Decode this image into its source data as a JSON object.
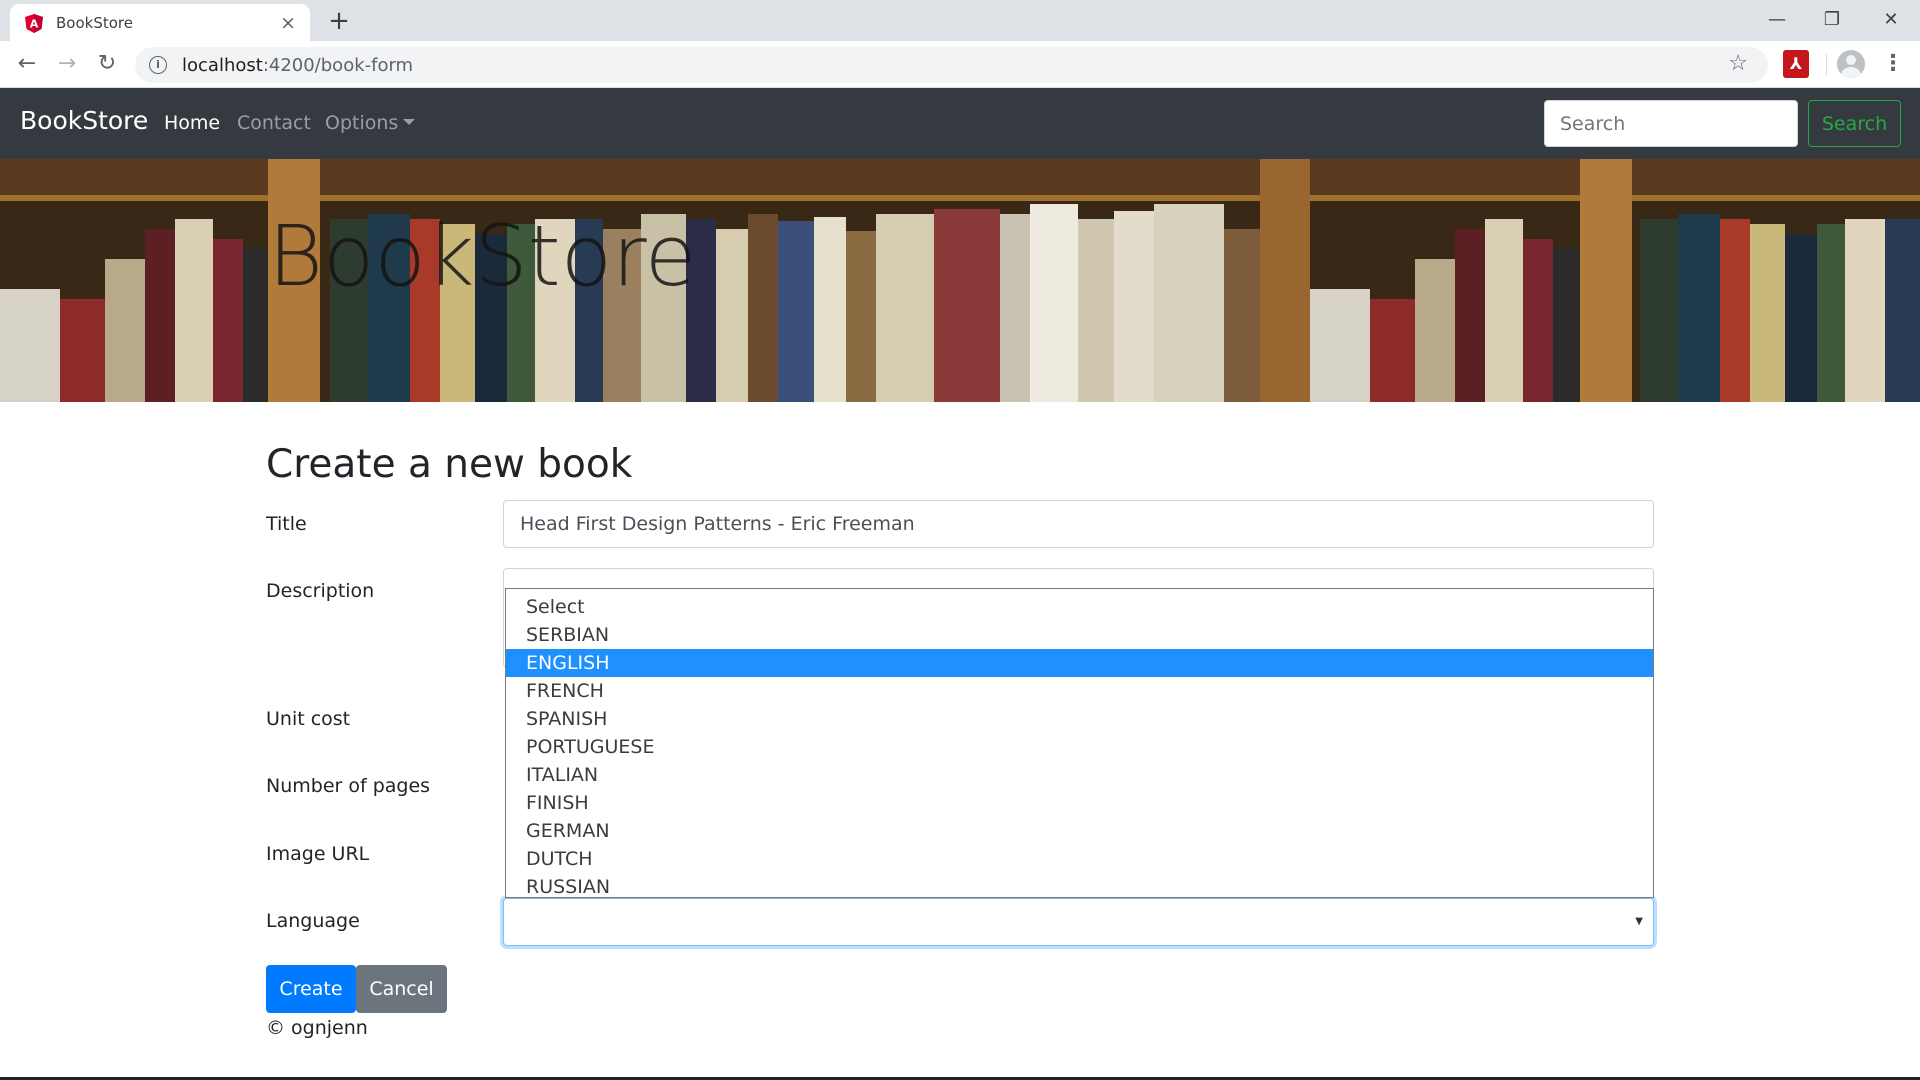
{
  "browser": {
    "tab_title": "BookStore",
    "url_host": "localhost",
    "url_path": ":4200/book-form",
    "new_tab": "+",
    "close_tab": "×",
    "minimize": "—",
    "restore": "❐",
    "close_window": "✕",
    "ext_label": "A"
  },
  "navbar": {
    "brand": "BookStore",
    "links": [
      "Home",
      "Contact",
      "Options"
    ],
    "search_placeholder": "Search",
    "search_button": "Search"
  },
  "hero": {
    "title": "BookStore"
  },
  "form": {
    "heading": "Create a new book",
    "title_label": "Title",
    "title_value": "Head First Design Patterns - Eric Freeman",
    "description_label": "Description",
    "unit_cost_label": "Unit cost",
    "pages_label": "Number of pages",
    "image_label": "Image URL",
    "language_label": "Language",
    "language_value": "",
    "language_options": [
      "Select",
      "SERBIAN",
      "ENGLISH",
      "FRENCH",
      "SPANISH",
      "PORTUGUESE",
      "ITALIAN",
      "FINISH",
      "GERMAN",
      "DUTCH",
      "RUSSIAN"
    ],
    "highlighted_option": "ENGLISH",
    "create_button": "Create",
    "cancel_button": "Cancel"
  },
  "footer": {
    "text": "© ognjenn"
  },
  "colors": {
    "navbar_bg": "#343a40",
    "primary": "#007bff",
    "secondary": "#6c757d",
    "success": "#28a745",
    "option_highlight": "#1e90ff"
  }
}
